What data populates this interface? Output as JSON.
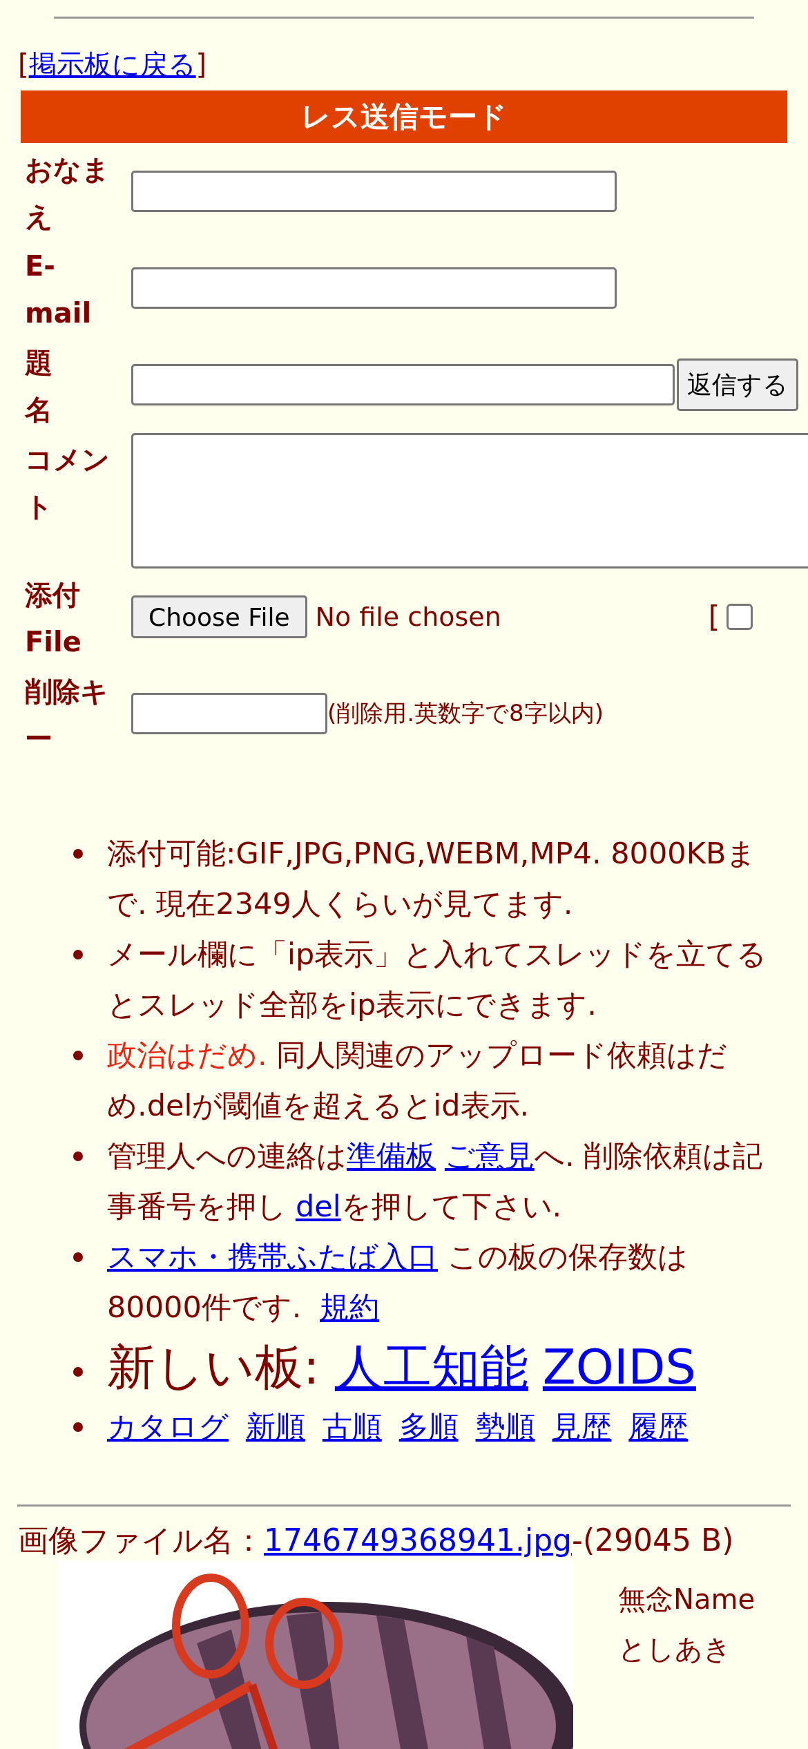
{
  "back_link": {
    "open": "[",
    "label": "掲示板に戻る",
    "close": "]"
  },
  "form": {
    "title": "レス送信モード",
    "rows": [
      {
        "label": "おなまえ",
        "kind": "text"
      },
      {
        "label": "E-mail",
        "kind": "text"
      },
      {
        "label": "題名",
        "kind": "subject",
        "button": "返信する"
      },
      {
        "label": "コメント",
        "kind": "textarea"
      },
      {
        "label": "添付File",
        "kind": "file",
        "button": "Choose File",
        "status": "No file chosen",
        "bracket": "[",
        "checked": false
      },
      {
        "label": "削除キー",
        "kind": "key",
        "hint": "(削除用.英数字で8字以内)"
      }
    ]
  },
  "notices": [
    {
      "kind": "text",
      "segments": [
        {
          "kind": "plain",
          "text": "添付可能:GIF,JPG,PNG,WEBM,MP4. 8000KBまで. 現在2349人くらいが見てます."
        }
      ]
    },
    {
      "kind": "text",
      "segments": [
        {
          "kind": "plain",
          "text": "メール欄に「ip表示」と入れてスレッドを立てるとスレッド全部をip表示にできます."
        }
      ]
    },
    {
      "kind": "text",
      "segments": [
        {
          "kind": "red",
          "text": "政治はだめ."
        },
        {
          "kind": "plain",
          "text": " 同人関連のアップロード依頼はだめ.delが閾値を超えるとid表示."
        }
      ]
    },
    {
      "kind": "text",
      "segments": [
        {
          "kind": "plain",
          "text": "管理人への連絡は"
        },
        {
          "kind": "link",
          "text": "準備板"
        },
        {
          "kind": "link",
          "text": "ご意見"
        },
        {
          "kind": "plain",
          "text": "へ. 削除依頼は記事番号を押し"
        },
        {
          "kind": "link",
          "text": "del"
        },
        {
          "kind": "plain",
          "text": "を押して下さい."
        }
      ]
    },
    {
      "kind": "text",
      "segments": [
        {
          "kind": "link",
          "text": "スマホ・携帯ふたば入口"
        },
        {
          "kind": "plain",
          "text": " この板の保存数は80000件です. "
        },
        {
          "kind": "link",
          "text": "規約"
        }
      ]
    },
    {
      "kind": "large",
      "segments": [
        {
          "kind": "plain",
          "text": "新しい板: "
        },
        {
          "kind": "link",
          "text": "人工知能"
        },
        {
          "kind": "link",
          "text": "ZOIDS"
        }
      ]
    },
    {
      "kind": "links",
      "segments": [
        {
          "kind": "link",
          "text": "カタログ"
        },
        {
          "kind": "link",
          "text": "新順"
        },
        {
          "kind": "link",
          "text": "古順"
        },
        {
          "kind": "link",
          "text": "多順"
        },
        {
          "kind": "link",
          "text": "勢順"
        },
        {
          "kind": "link",
          "text": "見歴"
        },
        {
          "kind": "link",
          "text": "履歴"
        }
      ]
    }
  ],
  "post": {
    "file_label": "画像ファイル名：",
    "file_link": "1746749368941.jpg",
    "file_size": "-(29045 B)",
    "name_label": "無念Name",
    "author": "としあき"
  }
}
